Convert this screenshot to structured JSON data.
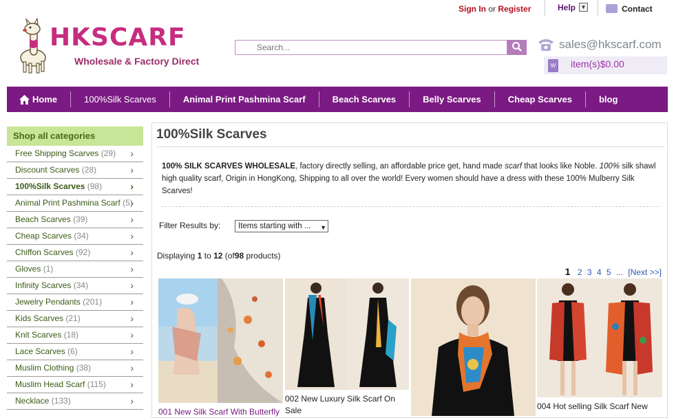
{
  "header": {
    "sign_in": "Sign In",
    "or": "or",
    "register": "Register",
    "help": "Help",
    "contact": "Contact",
    "logo_text": "HKSCARF",
    "logo_tagline": "Wholesale & Factory Direct",
    "search_placeholder": "Search...",
    "email": "sales@hkscarf.com",
    "cart": "item(s)$0.00"
  },
  "nav": {
    "items": [
      "Home",
      "100%Silk Scarves",
      "Animal Print Pashmina Scarf",
      "Beach Scarves",
      "Belly Scarves",
      "Cheap Scarves",
      "blog"
    ]
  },
  "sidebar": {
    "title": "Shop all categories",
    "items": [
      {
        "name": "Free Shipping Scarves",
        "count": "(29)"
      },
      {
        "name": "Discount Scarves",
        "count": "(28)"
      },
      {
        "name": "100%Silk Scarves",
        "count": "(98)"
      },
      {
        "name": "Animal Print Pashmina Scarf",
        "count": "(5)"
      },
      {
        "name": "Beach Scarves",
        "count": "(39)"
      },
      {
        "name": "Cheap Scarves",
        "count": "(34)"
      },
      {
        "name": "Chiffon Scarves",
        "count": "(92)"
      },
      {
        "name": "Gloves",
        "count": "(1)"
      },
      {
        "name": "Infinity Scarves",
        "count": "(34)"
      },
      {
        "name": "Jewelry Pendants",
        "count": "(201)"
      },
      {
        "name": "Kids Scarves",
        "count": "(21)"
      },
      {
        "name": "Knit Scarves",
        "count": "(18)"
      },
      {
        "name": "Lace Scarves",
        "count": "(6)"
      },
      {
        "name": "Muslim Clothing",
        "count": "(38)"
      },
      {
        "name": "Muslim Head Scarf",
        "count": "(115)"
      },
      {
        "name": "Necklace",
        "count": "(133)"
      }
    ]
  },
  "main": {
    "title": "100%Silk Scarves",
    "desc_bold": "100% SILK SCARVES WHOLESALE",
    "desc_1": ", factory directly selling, an affordable price get, hand made ",
    "desc_scarf": "scarf",
    "desc_2": " that looks like Noble. ",
    "desc_100": "100%",
    "desc_3": " silk shawl high quality scarf, Origin in HongKong, Shipping to all over the world! Every women should have a dress with these 100% Mulberry Silk Scarves!",
    "filter_label": "Filter Results by:",
    "filter_value": "Items starting with ...",
    "displaying_prefix": "Displaying",
    "displaying_from": "1",
    "displaying_to_word": "to",
    "displaying_to": "12",
    "displaying_of": "(of",
    "displaying_total": "98",
    "displaying_suffix": "products)",
    "pages": [
      "1",
      "2",
      "3",
      "4",
      "5",
      "...",
      "[Next >>]"
    ],
    "products": [
      {
        "name": "001 New Silk Scarf With Butterfly"
      },
      {
        "name": "002 New Luxury Silk Scarf On Sale"
      },
      {
        "name": ""
      },
      {
        "name": "004 Hot selling Silk Scarf New"
      }
    ]
  }
}
